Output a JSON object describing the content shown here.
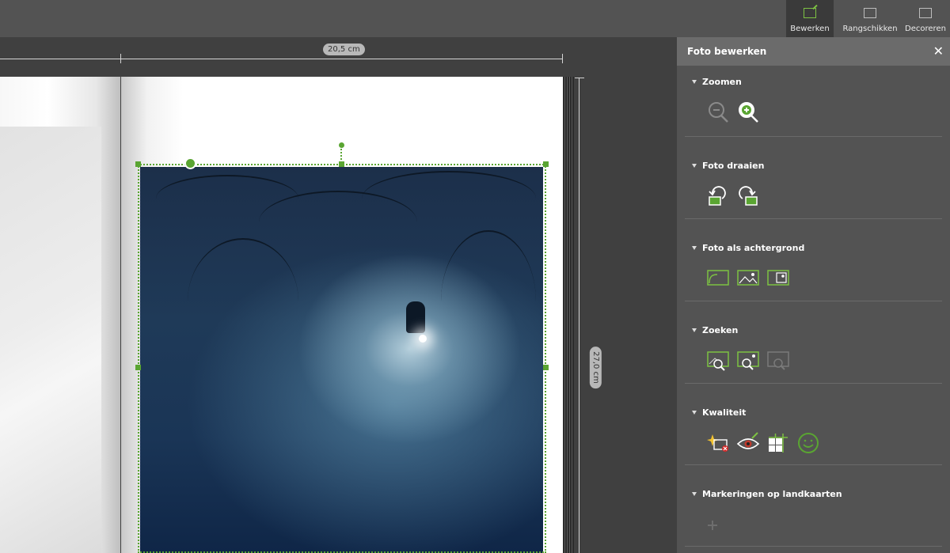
{
  "toolbar": {
    "tabs": [
      {
        "label": "Bewerken",
        "active": true
      },
      {
        "label": "Rangschikken",
        "active": false
      },
      {
        "label": "Decoreren",
        "active": false
      }
    ]
  },
  "canvas": {
    "width_label": "20,5 cm",
    "height_label": "27,0 cm"
  },
  "panel": {
    "title": "Foto bewerken",
    "sections": [
      {
        "title": "Zoomen",
        "icons": [
          "zoom-out-icon",
          "zoom-in-icon"
        ]
      },
      {
        "title": "Foto draaien",
        "icons": [
          "rotate-left-icon",
          "rotate-right-icon"
        ]
      },
      {
        "title": "Foto als achtergrond",
        "icons": [
          "background-left-icon",
          "background-full-icon",
          "background-right-icon"
        ]
      },
      {
        "title": "Zoeken",
        "icons": [
          "search-photo-icon",
          "search-similar-icon",
          "search-disabled-icon"
        ]
      },
      {
        "title": "Kwaliteit",
        "icons": [
          "auto-fix-icon",
          "red-eye-icon",
          "color-grid-icon",
          "smile-icon"
        ]
      },
      {
        "title": "Markeringen op landkaarten",
        "icons": [
          "add-marker-icon"
        ]
      }
    ]
  },
  "colors": {
    "accent": "#7dc243",
    "selection": "#5aa532",
    "panel_bg": "#535353",
    "panel_header": "#6b6b6b"
  }
}
